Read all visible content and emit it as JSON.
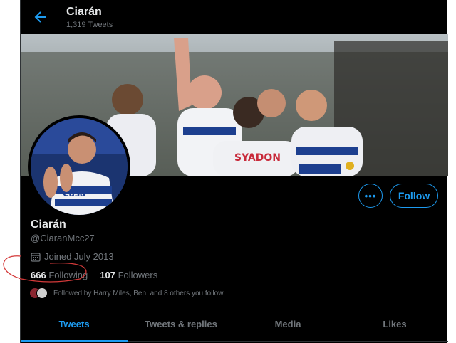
{
  "header": {
    "back_icon": "arrow-left-icon",
    "name": "Ciarán",
    "tweet_count": "1,319 Tweets"
  },
  "banner": {
    "image_label": "banner-photo",
    "banner_text": "SYADON"
  },
  "avatar": {
    "shirt_text": "Casa"
  },
  "actions": {
    "more_icon": "ellipsis-icon",
    "more_label": "•••",
    "follow_label": "Follow"
  },
  "profile": {
    "name": "Ciarán",
    "handle": "@CiaranMcc27",
    "joined_icon": "calendar-icon",
    "joined": "Joined July 2013",
    "following_count": "666",
    "following_label": "Following",
    "followers_count": "107",
    "followers_label": "Followers",
    "followed_by": "Followed by Harry Miles, Ben, and 8 others you follow"
  },
  "tabs": [
    {
      "label": "Tweets"
    },
    {
      "label": "Tweets & replies"
    },
    {
      "label": "Media"
    },
    {
      "label": "Likes"
    }
  ],
  "colors": {
    "accent": "#1d9bf0",
    "background": "#000000",
    "primary_text": "#e7e9ea",
    "secondary_text": "#71767b",
    "annotation": "#d43a3a"
  }
}
